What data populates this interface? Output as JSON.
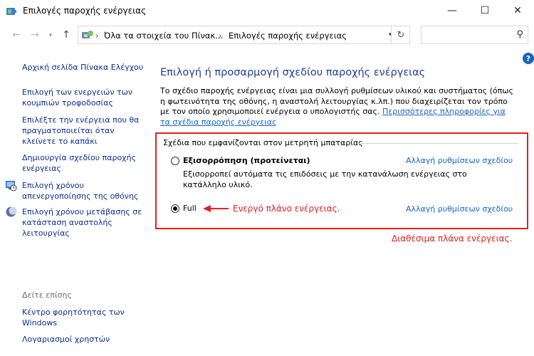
{
  "window": {
    "title": "Επιλογές παροχής ενέργειας",
    "minimize": "—",
    "maximize": "☐",
    "close": "✕"
  },
  "address_bar": {
    "segments": [
      "Όλα τα στοιχεία του Πίνακ...",
      "Επιλογές παροχής ενέργειας"
    ],
    "separator": "›",
    "search_placeholder": ""
  },
  "sidebar": {
    "home": "Αρχική σελίδα Πίνακα Ελέγχου",
    "links": [
      "Επιλογή των ενεργειών των κουμπιών τροφοδοσίας",
      "Επιλέξτε την ενέργεια που θα πραγματοποιείται όταν κλείνετε το καπάκι",
      "Δημιουργία σχεδίου παροχής ενέργειας",
      "Επιλογή χρόνου απενεργοποίησης της οθόνης",
      "Επιλογή χρόνου μετάβασης σε κατάσταση αναστολής λειτουργίας"
    ],
    "see_also_label": "Δείτε επίσης",
    "see_also": [
      "Κέντρο φορητότητας των Windows",
      "Λογαριασμοί χρηστών"
    ]
  },
  "main": {
    "title": "Επιλογή ή προσαρμογή σχεδίου παροχής ενέργειας",
    "description": "Το σχέδιο παροχής ενέργειας είναι μια συλλογή ρυθμίσεων υλικού και συστήματος (όπως η φωτεινότητα της οθόνης, η αναστολή λειτουργίας κ.λπ.) που διαχειρίζεται τον τρόπο με τον οποίο χρησιμοποιεί ενέργεια ο υπολογιστής σας.",
    "more_info": "Περισσότερες πληροφορίες για τα σχέδια παροχής ενέργειας",
    "group_label": "Σχέδια που εμφανίζονται στον μετρητή μπαταρίας",
    "plans": [
      {
        "name": "Εξισορρόπηση (προτείνεται)",
        "description": "Εξισορροπεί αυτόματα τις επιδόσεις με την κατανάλωση ενέργειας στο κατάλληλο υλικό.",
        "change_link": "Αλλαγή ρυθμίσεων σχεδίου",
        "selected": false
      },
      {
        "name": "Full",
        "change_link": "Αλλαγή ρυθμίσεων σχεδίου",
        "selected": true
      }
    ]
  },
  "annotations": {
    "active_plan": "Ενεργό πλάνο ενέργειας.",
    "available_plans": "Διαθέσιμα πλάνα ενέργειας.",
    "color": "#e32020"
  },
  "icons": {
    "app": "battery-control-panel-icon",
    "back": "back-arrow-icon",
    "forward": "forward-arrow-icon",
    "recent": "chevron-down-icon",
    "up": "up-arrow-icon",
    "refresh": "refresh-icon",
    "search": "search-icon",
    "help": "help-icon",
    "display": "display-clock-icon",
    "sleep": "moon-icon"
  },
  "colors": {
    "link": "#0b2f8f",
    "title": "#1e3e9a",
    "highlight": "#e32020"
  }
}
